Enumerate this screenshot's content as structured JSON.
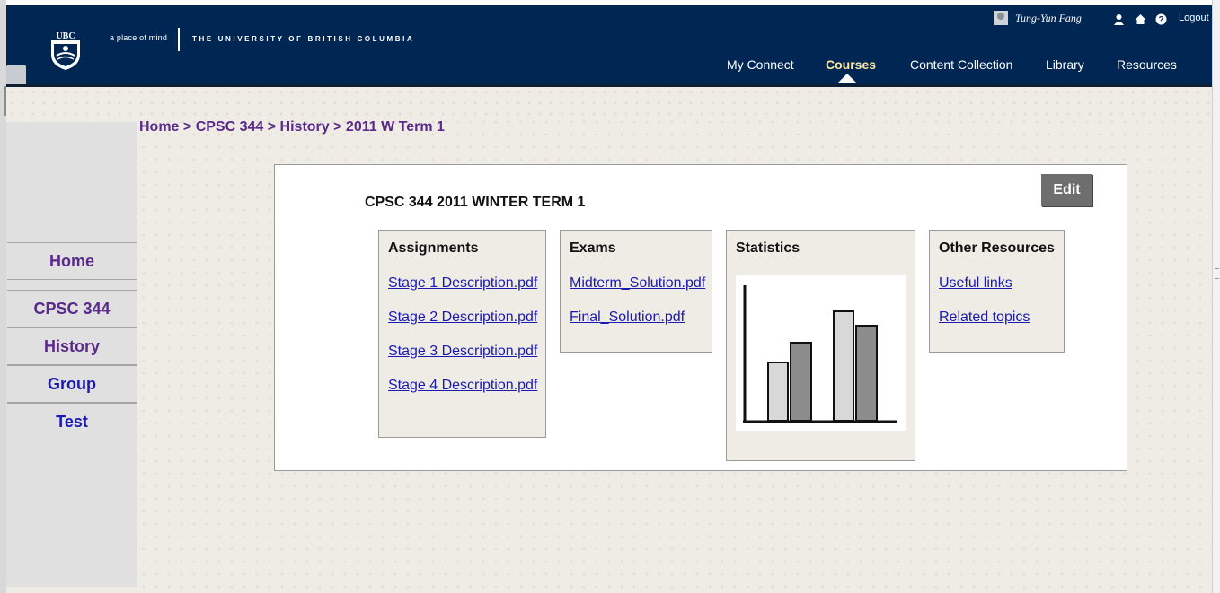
{
  "header": {
    "tagline": "a place of mind",
    "university": "THE UNIVERSITY OF BRITISH COLUMBIA",
    "logo_text": "UBC",
    "user_name": "Tung-Yun Fang",
    "logout": "Logout",
    "nav": [
      {
        "label": "My Connect",
        "active": false
      },
      {
        "label": "Courses",
        "active": true
      },
      {
        "label": "Content Collection",
        "active": false
      },
      {
        "label": "Library",
        "active": false
      },
      {
        "label": "Resources",
        "active": false
      }
    ],
    "icons": [
      "user-icon",
      "home-icon",
      "help-icon"
    ]
  },
  "breadcrumb": {
    "items": [
      "Home",
      "CPSC 344",
      "History",
      "2011 W Term 1"
    ],
    "separator": ">"
  },
  "sidebar": {
    "items": [
      {
        "label": "Home",
        "color": "#5a2a8a"
      },
      {
        "label": "CPSC 344",
        "color": "#5a2a8a"
      },
      {
        "label": "History",
        "color": "#5a2a8a"
      },
      {
        "label": "Group",
        "color": "#1a1ab0"
      },
      {
        "label": "Test",
        "color": "#1a1ab0"
      }
    ]
  },
  "main": {
    "title": "CPSC 344 2011 WINTER TERM 1",
    "edit_label": "Edit",
    "cards": {
      "assignments": {
        "title": "Assignments",
        "links": [
          "Stage 1 Description.pdf",
          "Stage 2 Description.pdf",
          "Stage 3 Description.pdf",
          "Stage 4 Description.pdf"
        ]
      },
      "exams": {
        "title": "Exams",
        "links": [
          "Midterm_Solution.pdf",
          "Final_Solution.pdf"
        ]
      },
      "statistics": {
        "title": "Statistics",
        "image": "bar-chart-illustration"
      },
      "other": {
        "title": "Other Resources",
        "links": [
          "Useful links",
          "Related topics"
        ]
      }
    }
  },
  "colors": {
    "header_bg": "#002654",
    "page_bg": "#efece5",
    "link": "#1a1ab0",
    "breadcrumb": "#5a2a8a",
    "active_nav": "#ffe9a0"
  }
}
